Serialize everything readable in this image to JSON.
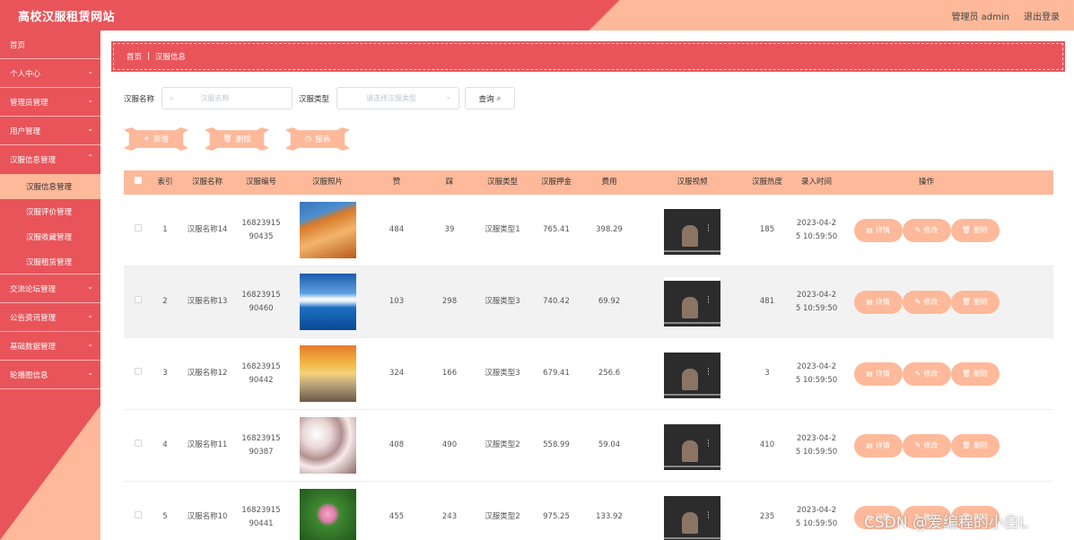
{
  "header": {
    "title": "高校汉服租赁网站",
    "user_label": "管理员 admin",
    "logout_label": "退出登录"
  },
  "sidebar": {
    "items": [
      {
        "label": "首页",
        "has_chevron": false
      },
      {
        "label": "个人中心",
        "has_chevron": true
      },
      {
        "label": "管理员管理",
        "has_chevron": true
      },
      {
        "label": "用户管理",
        "has_chevron": true
      },
      {
        "label": "汉服信息管理",
        "has_chevron": true
      },
      {
        "label": "交流论坛管理",
        "has_chevron": true
      },
      {
        "label": "公告资讯管理",
        "has_chevron": true
      },
      {
        "label": "基础数据管理",
        "has_chevron": true
      },
      {
        "label": "轮播图信息",
        "has_chevron": true
      }
    ],
    "subitems": [
      "汉服信息管理",
      "汉服评价管理",
      "汉服收藏管理",
      "汉服租赁管理"
    ]
  },
  "breadcrumb": {
    "home": "首页",
    "sep": "|",
    "current": "汉服信息"
  },
  "search": {
    "name_label": "汉服名称",
    "name_placeholder": "汉服名称",
    "type_label": "汉服类型",
    "type_placeholder": "请选择汉服类型",
    "query_label": "查询"
  },
  "actions": {
    "add": "新增",
    "delete": "删除",
    "report": "报表"
  },
  "table": {
    "headers": [
      "索引",
      "汉服名称",
      "汉服编号",
      "汉服照片",
      "赞",
      "踩",
      "汉服类型",
      "汉服押金",
      "费用",
      "汉服视频",
      "汉服热度",
      "录入时间",
      "操作"
    ],
    "rows": [
      {
        "index": "1",
        "name": "汉服名称14",
        "code1": "16823915",
        "code2": "90435",
        "likes": "484",
        "dislikes": "39",
        "type": "汉服类型1",
        "deposit": "765.41",
        "fee": "398.29",
        "heat": "185",
        "time1": "2023-04-2",
        "time2": "5 10:59:50"
      },
      {
        "index": "2",
        "name": "汉服名称13",
        "code1": "16823915",
        "code2": "90460",
        "likes": "103",
        "dislikes": "298",
        "type": "汉服类型3",
        "deposit": "740.42",
        "fee": "69.92",
        "heat": "481",
        "time1": "2023-04-2",
        "time2": "5 10:59:50"
      },
      {
        "index": "3",
        "name": "汉服名称12",
        "code1": "16823915",
        "code2": "90442",
        "likes": "324",
        "dislikes": "166",
        "type": "汉服类型3",
        "deposit": "679.41",
        "fee": "256.6",
        "heat": "3",
        "time1": "2023-04-2",
        "time2": "5 10:59:50"
      },
      {
        "index": "4",
        "name": "汉服名称11",
        "code1": "16823915",
        "code2": "90387",
        "likes": "408",
        "dislikes": "490",
        "type": "汉服类型2",
        "deposit": "558.99",
        "fee": "59.04",
        "heat": "410",
        "time1": "2023-04-2",
        "time2": "5 10:59:50"
      },
      {
        "index": "5",
        "name": "汉服名称10",
        "code1": "16823915",
        "code2": "90441",
        "likes": "455",
        "dislikes": "243",
        "type": "汉服类型2",
        "deposit": "975.25",
        "fee": "133.92",
        "heat": "235",
        "time1": "2023-04-2",
        "time2": "5 10:59:50"
      }
    ],
    "row_actions": {
      "detail": "详情",
      "edit": "修改",
      "delete": "删除"
    }
  },
  "watermark": "CSDN @爱编程的小白L",
  "colors": {
    "primary": "#e9545a",
    "accent": "#fdb99a"
  }
}
